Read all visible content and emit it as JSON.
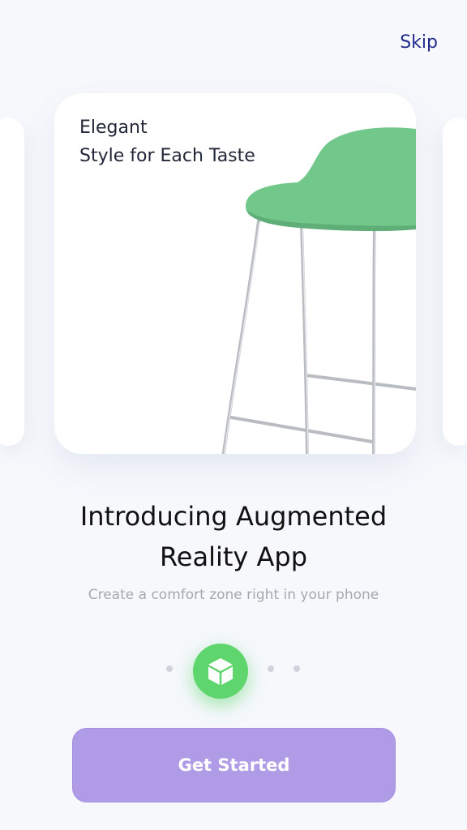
{
  "header": {
    "skip_label": "Skip"
  },
  "card": {
    "tagline_line1": "Elegant",
    "tagline_line2": "Style for Each Taste",
    "image": "green-bar-stool"
  },
  "main": {
    "title_line1": "Introducing Augmented",
    "title_line2": "Reality App",
    "subtitle": "Create a comfort zone right in your phone"
  },
  "pagination": {
    "total": 4,
    "active_index": 2,
    "active_icon": "cube-icon"
  },
  "cta": {
    "label": "Get Started"
  },
  "colors": {
    "background": "#f6f8fc",
    "skip": "#232c8c",
    "active_dot": "#5fd66d",
    "cta": "#b09ce6",
    "stool_seat": "#72c88a"
  }
}
